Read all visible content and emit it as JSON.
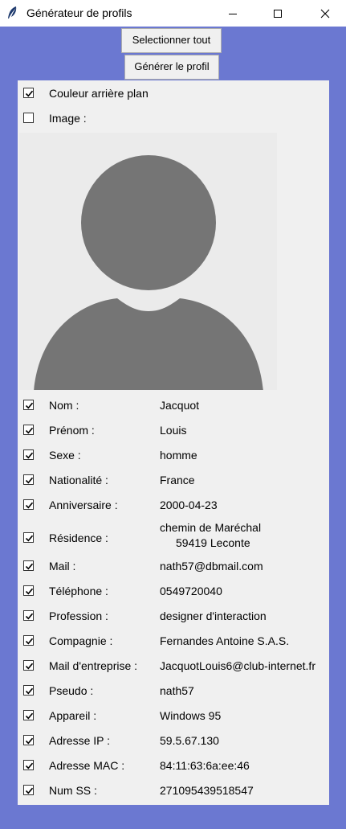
{
  "window": {
    "title": "Générateur de profils",
    "controls": {
      "minimize": "minimize-icon",
      "maximize": "maximize-icon",
      "close": "close-icon"
    }
  },
  "toolbar": {
    "select_all_label": "Selectionner tout",
    "generate_label": "Générer le profil"
  },
  "options": {
    "background_color": {
      "label": "Couleur arrière plan",
      "checked": true
    },
    "image": {
      "label": "Image :",
      "checked": false
    }
  },
  "fields": [
    {
      "label": "Nom :",
      "value": "Jacquot",
      "checked": true
    },
    {
      "label": "Prénom :",
      "value": "Louis",
      "checked": true
    },
    {
      "label": "Sexe :",
      "value": "homme",
      "checked": true
    },
    {
      "label": "Nationalité :",
      "value": "France",
      "checked": true
    },
    {
      "label": "Anniversaire :",
      "value": "2000-04-23",
      "checked": true
    },
    {
      "label": "Résidence :",
      "value_line1": "chemin de Maréchal",
      "value_line2": "59419 Leconte",
      "checked": true
    },
    {
      "label": "Mail :",
      "value": "nath57@dbmail.com",
      "checked": true
    },
    {
      "label": "Téléphone :",
      "value": "0549720040",
      "checked": true
    },
    {
      "label": "Profession :",
      "value": "designer d'interaction",
      "checked": true
    },
    {
      "label": "Compagnie :",
      "value": "Fernandes Antoine S.A.S.",
      "checked": true
    },
    {
      "label": "Mail d'entreprise :",
      "value": "JacquotLouis6@club-internet.fr",
      "checked": true
    },
    {
      "label": "Pseudo :",
      "value": "nath57",
      "checked": true
    },
    {
      "label": "Appareil :",
      "value": "Windows 95",
      "checked": true
    },
    {
      "label": "Adresse IP :",
      "value": "59.5.67.130",
      "checked": true
    },
    {
      "label": "Adresse MAC :",
      "value": "84:11:63:6a:ee:46",
      "checked": true
    },
    {
      "label": "Num SS :",
      "value": "271095439518547",
      "checked": true
    }
  ],
  "colors": {
    "window_background": "#6b78d1",
    "panel": "#f0f0f0",
    "avatar_fill": "#757575",
    "avatar_background": "#ebebeb"
  }
}
